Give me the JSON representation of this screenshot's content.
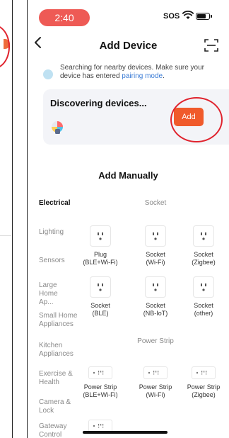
{
  "status": {
    "time": "2:40",
    "sos": "SOS"
  },
  "nav": {
    "title": "Add Device"
  },
  "banner": {
    "text": "Searching for nearby devices. Make sure your device has entered ",
    "link": "pairing mode",
    "suffix": "."
  },
  "discover": {
    "title": "Discovering devices...",
    "add_label": "Add"
  },
  "manual": {
    "title": "Add Manually"
  },
  "categories": [
    {
      "label": "Electrical",
      "active": true
    },
    {
      "label": "Lighting",
      "active": false
    },
    {
      "label": "Sensors",
      "active": false
    },
    {
      "label": "Large Home Ap...",
      "active": false
    },
    {
      "label": "Small Home Appliances",
      "active": false
    },
    {
      "label": "Kitchen Appliances",
      "active": false
    },
    {
      "label": "Exercise & Health",
      "active": false
    },
    {
      "label": "Camera & Lock",
      "active": false
    },
    {
      "label": "Gateway Control",
      "active": false
    }
  ],
  "groups": {
    "socket": {
      "title": "Socket",
      "items": [
        {
          "label": "Plug\n(BLE+Wi-Fi)"
        },
        {
          "label": "Socket\n(Wi-Fi)"
        },
        {
          "label": "Socket\n(Zigbee)"
        },
        {
          "label": "Socket\n(BLE)"
        },
        {
          "label": "Socket\n(NB-IoT)"
        },
        {
          "label": "Socket\n(other)"
        }
      ]
    },
    "power_strip": {
      "title": "Power Strip",
      "items": [
        {
          "label": "Power Strip\n(BLE+Wi-Fi)"
        },
        {
          "label": "Power Strip\n(Wi-Fi)"
        },
        {
          "label": "Power Strip\n(Zigbee)"
        }
      ]
    }
  },
  "colors": {
    "accent": "#f05a2b",
    "link": "#3a7bd5",
    "highlight": "#e0232e",
    "time_pill": "#ee5a55"
  }
}
